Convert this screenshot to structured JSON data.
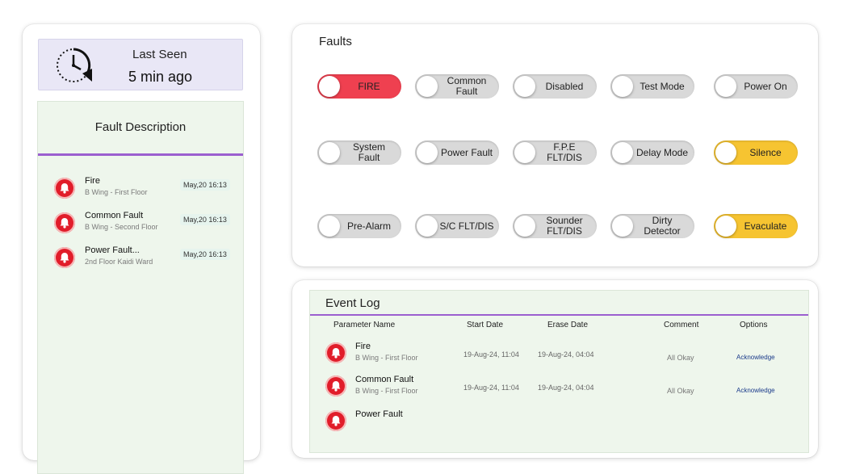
{
  "last_seen": {
    "label": "Last Seen",
    "value": "5 min ago",
    "icon": "clock-history-icon"
  },
  "fault_description": {
    "title": "Fault Description",
    "items": [
      {
        "name": "Fire",
        "location": "B Wing - First Floor",
        "time": "May,20 16:13",
        "icon": "bell-icon"
      },
      {
        "name": "Common Fault",
        "location": "B Wing - Second Floor",
        "time": "May,20 16:13",
        "icon": "bell-icon"
      },
      {
        "name": "Power Fault...",
        "location": "2nd Floor Kaidi Ward",
        "time": "May,20 16:13",
        "icon": "bell-icon"
      }
    ]
  },
  "faults": {
    "title": "Faults",
    "toggles": [
      {
        "label": "FIRE",
        "state": "on",
        "color": "#ef4050"
      },
      {
        "label": "Common Fault",
        "state": "off"
      },
      {
        "label": "Disabled",
        "state": "off"
      },
      {
        "label": "Test Mode",
        "state": "off"
      },
      {
        "label": "Power On",
        "state": "off"
      },
      {
        "label": "System Fault",
        "state": "off"
      },
      {
        "label": "Power Fault",
        "state": "off"
      },
      {
        "label": "F.P.E FLT/DIS",
        "state": "off"
      },
      {
        "label": "Delay Mode",
        "state": "off"
      },
      {
        "label": "Silence",
        "state": "on",
        "color": "#f6c431"
      },
      {
        "label": "Pre-Alarm",
        "state": "off"
      },
      {
        "label": "S/C FLT/DIS",
        "state": "off"
      },
      {
        "label": "Sounder FLT/DIS",
        "state": "off"
      },
      {
        "label": "Dirty Detector",
        "state": "off"
      },
      {
        "label": "Evaculate",
        "state": "on",
        "color": "#f6c431"
      }
    ]
  },
  "event_log": {
    "title": "Event Log",
    "columns": [
      "Parameter Name",
      "Start Date",
      "Erase Date",
      "Comment",
      "Options"
    ],
    "rows": [
      {
        "name": "Fire",
        "location": "B Wing - First Floor",
        "start": "19-Aug-24, 11:04",
        "erase": "19-Aug-24, 04:04",
        "comment": "All Okay",
        "option": "Acknowledge",
        "icon": "bell-icon"
      },
      {
        "name": "Common Fault",
        "location": "B Wing - First Floor",
        "start": "19-Aug-24, 11:04",
        "erase": "19-Aug-24, 04:04",
        "comment": "All Okay",
        "option": "Acknowledge",
        "icon": "bell-icon"
      },
      {
        "name": "Power Fault",
        "location": "",
        "start": "",
        "erase": "",
        "comment": "",
        "option": "",
        "icon": "bell-icon"
      }
    ]
  },
  "colors": {
    "accent_purple": "#9b5fcf",
    "alarm_red": "#e11d2a",
    "panel_green": "#eef6ec",
    "toggle_yellow": "#f6c431",
    "toggle_red": "#ef4050"
  }
}
